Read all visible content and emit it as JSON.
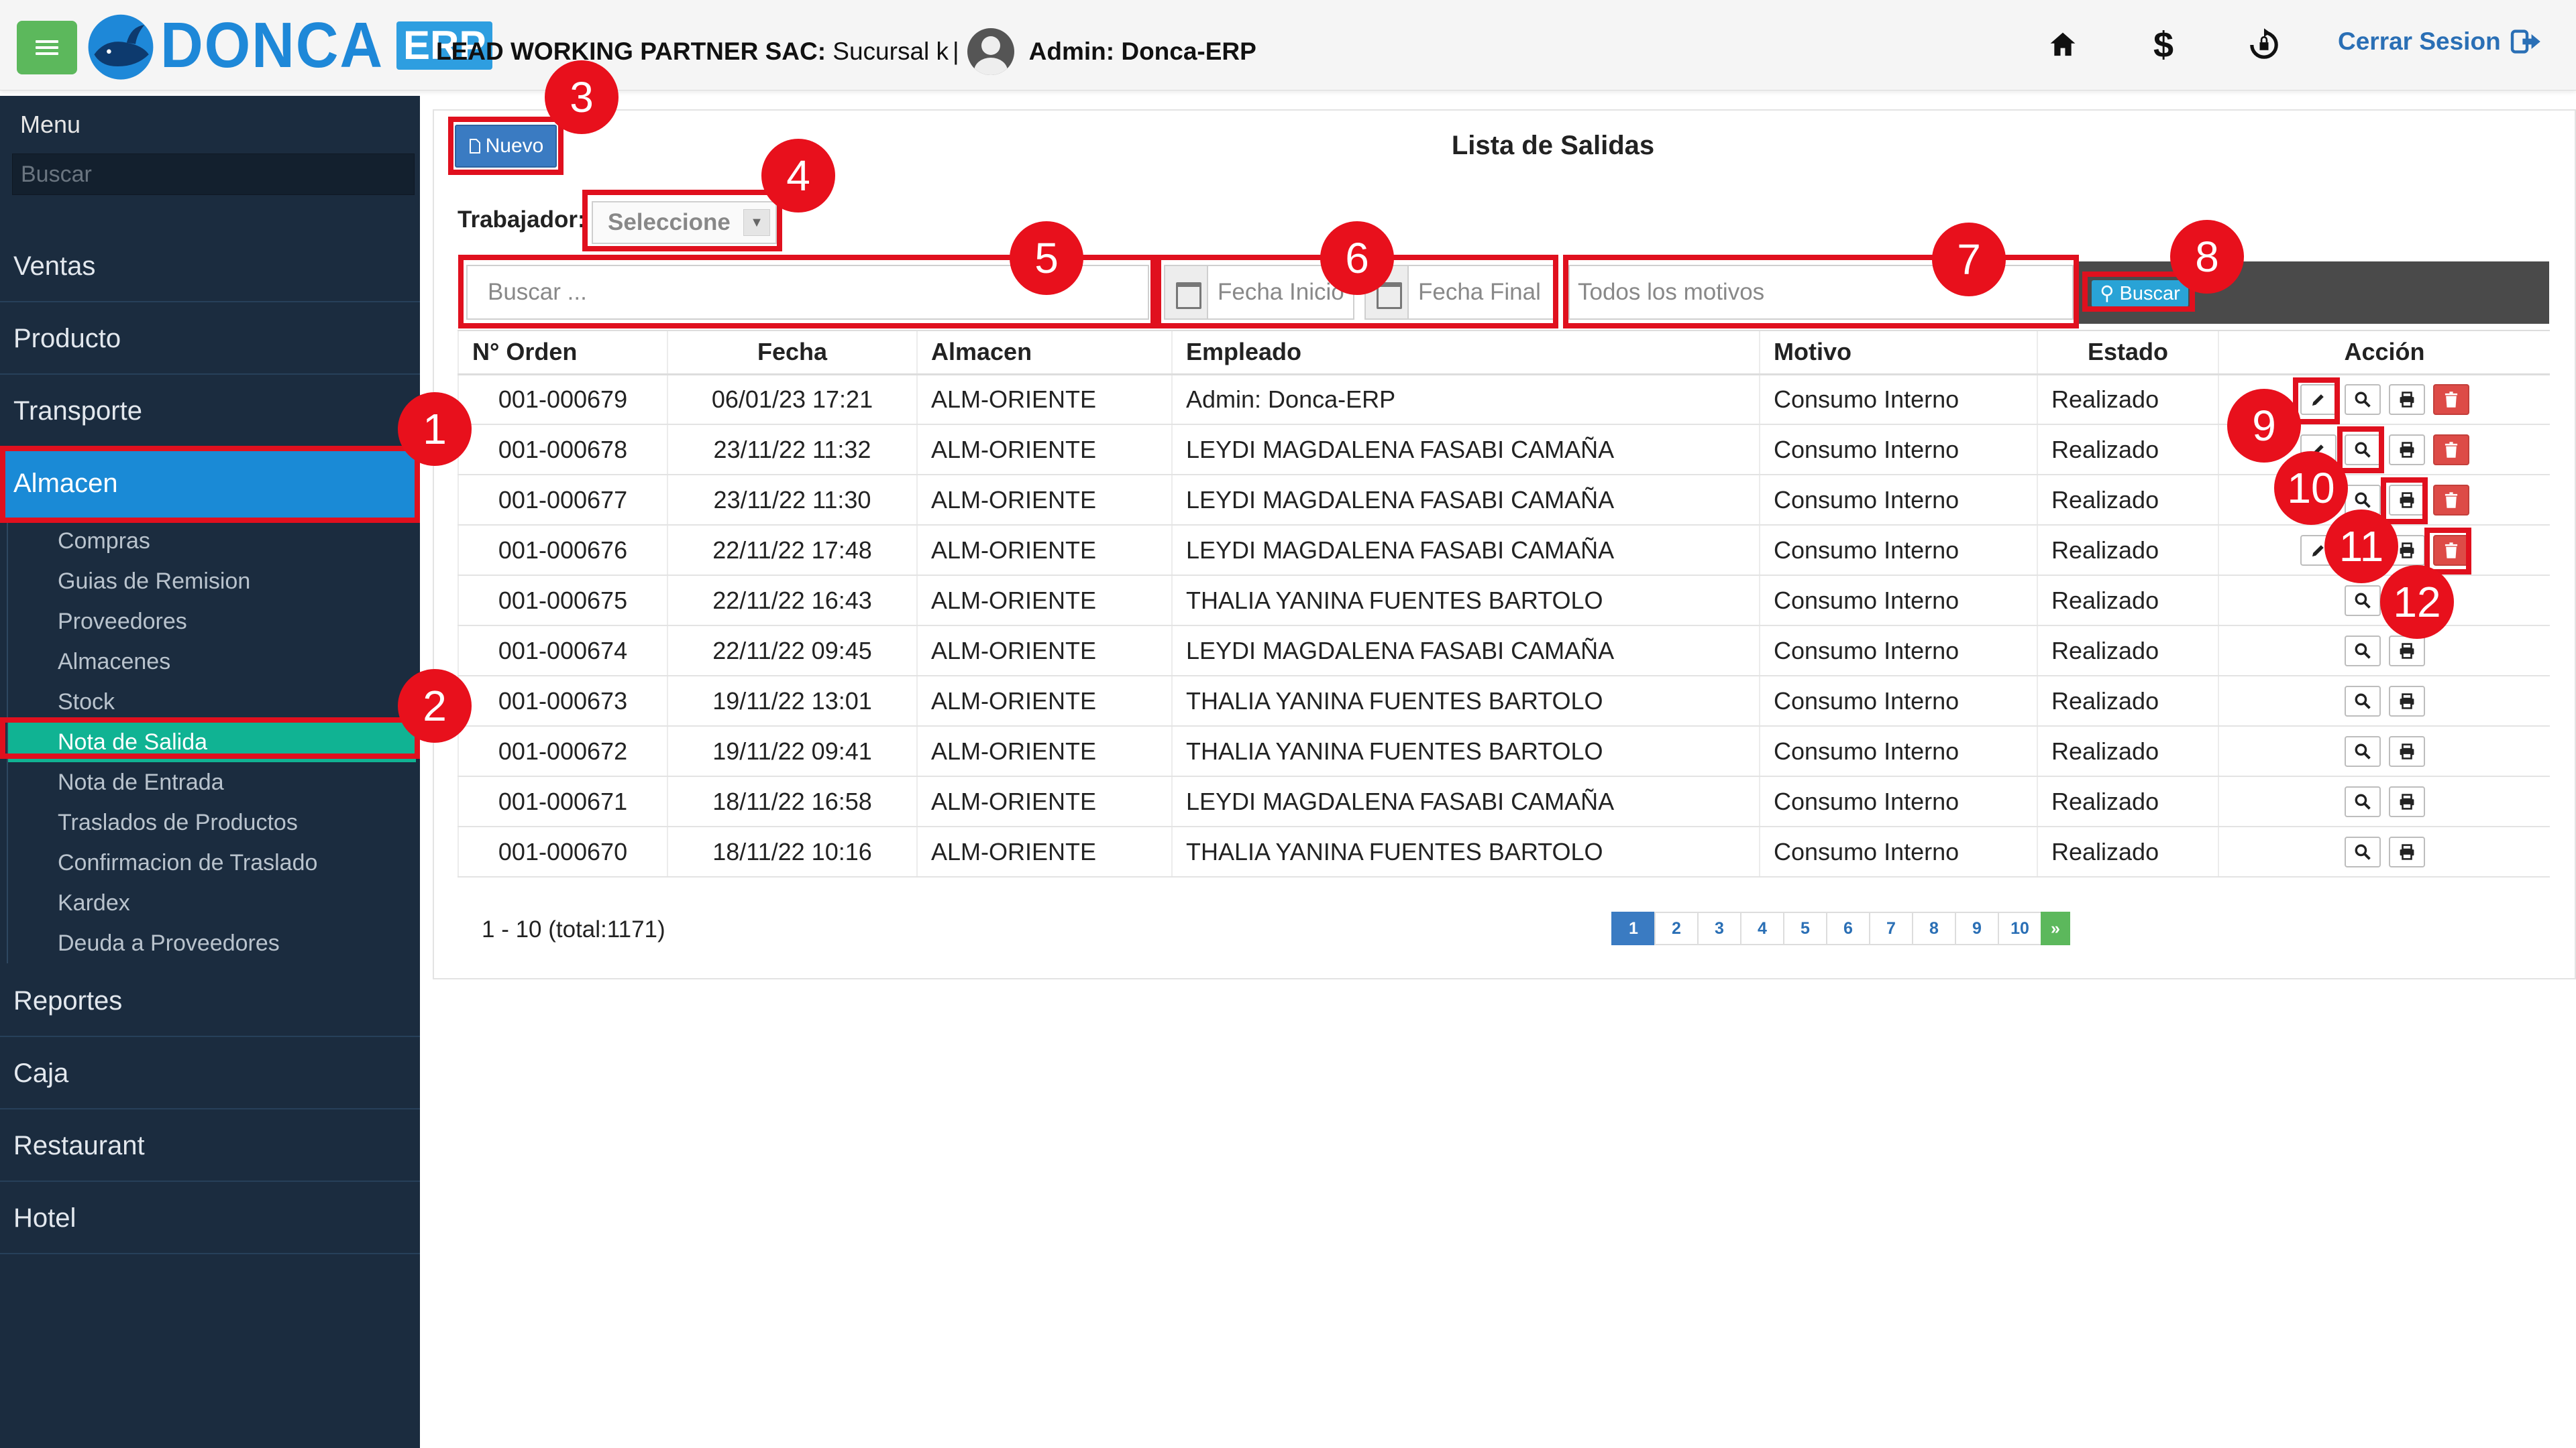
{
  "app": {
    "logo_text": "DONCA",
    "logo_badge": "ERP"
  },
  "header": {
    "company": "LEAD WORKING PARTNER SAC:",
    "branch": "Sucursal k",
    "separator": "|",
    "user": "Admin: Donca-ERP",
    "icons": [
      "home-icon",
      "dollar-icon",
      "sync-icon"
    ],
    "logout_label": "Cerrar Sesion"
  },
  "sidebar": {
    "title": "Menu",
    "search_placeholder": "Buscar",
    "items_top": [
      "Ventas",
      "Producto",
      "Transporte",
      "Almacen"
    ],
    "subitems": [
      "Compras",
      "Guias de Remision",
      "Proveedores",
      "Almacenes",
      "Stock",
      "Nota de Salida",
      "Nota de Entrada",
      "Traslados de Productos",
      "Confirmacion de Traslado",
      "Kardex",
      "Deuda a Proveedores"
    ],
    "items_bottom": [
      "Reportes",
      "Caja",
      "Restaurant",
      "Hotel"
    ],
    "active_item": "Almacen",
    "active_subitem": "Nota de Salida"
  },
  "main": {
    "new_button": "Nuevo",
    "title": "Lista de Salidas",
    "worker_label": "Trabajador:",
    "worker_select": "Seleccione",
    "search_placeholder": "Buscar ...",
    "date_start_placeholder": "Fecha Inicio",
    "date_end_placeholder": "Fecha Final",
    "reason_placeholder": "Todos los motivos",
    "search_button": "Buscar"
  },
  "table": {
    "columns": [
      "N° Orden",
      "Fecha",
      "Almacen",
      "Empleado",
      "Motivo",
      "Estado",
      "Acción"
    ],
    "rows": [
      {
        "orden": "001-000679",
        "fecha": "06/01/23 17:21",
        "almacen": "ALM-ORIENTE",
        "empleado": "Admin: Donca-ERP",
        "motivo": "Consumo Interno",
        "estado": "Realizado",
        "actions": [
          "edit",
          "view",
          "print",
          "delete"
        ]
      },
      {
        "orden": "001-000678",
        "fecha": "23/11/22 11:32",
        "almacen": "ALM-ORIENTE",
        "empleado": "LEYDI MAGDALENA FASABI CAMAÑA",
        "motivo": "Consumo Interno",
        "estado": "Realizado",
        "actions": [
          "edit",
          "view",
          "print",
          "delete"
        ]
      },
      {
        "orden": "001-000677",
        "fecha": "23/11/22 11:30",
        "almacen": "ALM-ORIENTE",
        "empleado": "LEYDI MAGDALENA FASABI CAMAÑA",
        "motivo": "Consumo Interno",
        "estado": "Realizado",
        "actions": [
          "edit",
          "view",
          "print",
          "delete"
        ]
      },
      {
        "orden": "001-000676",
        "fecha": "22/11/22 17:48",
        "almacen": "ALM-ORIENTE",
        "empleado": "LEYDI MAGDALENA FASABI CAMAÑA",
        "motivo": "Consumo Interno",
        "estado": "Realizado",
        "actions": [
          "edit",
          "view",
          "print",
          "delete"
        ]
      },
      {
        "orden": "001-000675",
        "fecha": "22/11/22 16:43",
        "almacen": "ALM-ORIENTE",
        "empleado": "THALIA YANINA FUENTES BARTOLO",
        "motivo": "Consumo Interno",
        "estado": "Realizado",
        "actions": [
          "view",
          "print"
        ]
      },
      {
        "orden": "001-000674",
        "fecha": "22/11/22 09:45",
        "almacen": "ALM-ORIENTE",
        "empleado": "LEYDI MAGDALENA FASABI CAMAÑA",
        "motivo": "Consumo Interno",
        "estado": "Realizado",
        "actions": [
          "view",
          "print"
        ]
      },
      {
        "orden": "001-000673",
        "fecha": "19/11/22 13:01",
        "almacen": "ALM-ORIENTE",
        "empleado": "THALIA YANINA FUENTES BARTOLO",
        "motivo": "Consumo Interno",
        "estado": "Realizado",
        "actions": [
          "view",
          "print"
        ]
      },
      {
        "orden": "001-000672",
        "fecha": "19/11/22 09:41",
        "almacen": "ALM-ORIENTE",
        "empleado": "THALIA YANINA FUENTES BARTOLO",
        "motivo": "Consumo Interno",
        "estado": "Realizado",
        "actions": [
          "view",
          "print"
        ]
      },
      {
        "orden": "001-000671",
        "fecha": "18/11/22 16:58",
        "almacen": "ALM-ORIENTE",
        "empleado": "LEYDI MAGDALENA FASABI CAMAÑA",
        "motivo": "Consumo Interno",
        "estado": "Realizado",
        "actions": [
          "view",
          "print"
        ]
      },
      {
        "orden": "001-000670",
        "fecha": "18/11/22 10:16",
        "almacen": "ALM-ORIENTE",
        "empleado": "THALIA YANINA FUENTES BARTOLO",
        "motivo": "Consumo Interno",
        "estado": "Realizado",
        "actions": [
          "view",
          "print"
        ]
      }
    ]
  },
  "pagination": {
    "range_text": "1 - 10 (total:1171)",
    "pages": [
      "1",
      "2",
      "3",
      "4",
      "5",
      "6",
      "7",
      "8",
      "9",
      "10"
    ],
    "next": "»",
    "current": "1"
  },
  "annotations": [
    "1",
    "2",
    "3",
    "4",
    "5",
    "6",
    "7",
    "8",
    "9",
    "10",
    "11",
    "12"
  ],
  "colors": {
    "primary": "#3a7bc2",
    "sidebar_bg": "#1b2c3f",
    "sidebar_active": "#1a8ad6",
    "submenu_active": "#10b393",
    "menu_button": "#5cb85c",
    "danger": "#dd4b47",
    "annotation": "#e8101c"
  }
}
